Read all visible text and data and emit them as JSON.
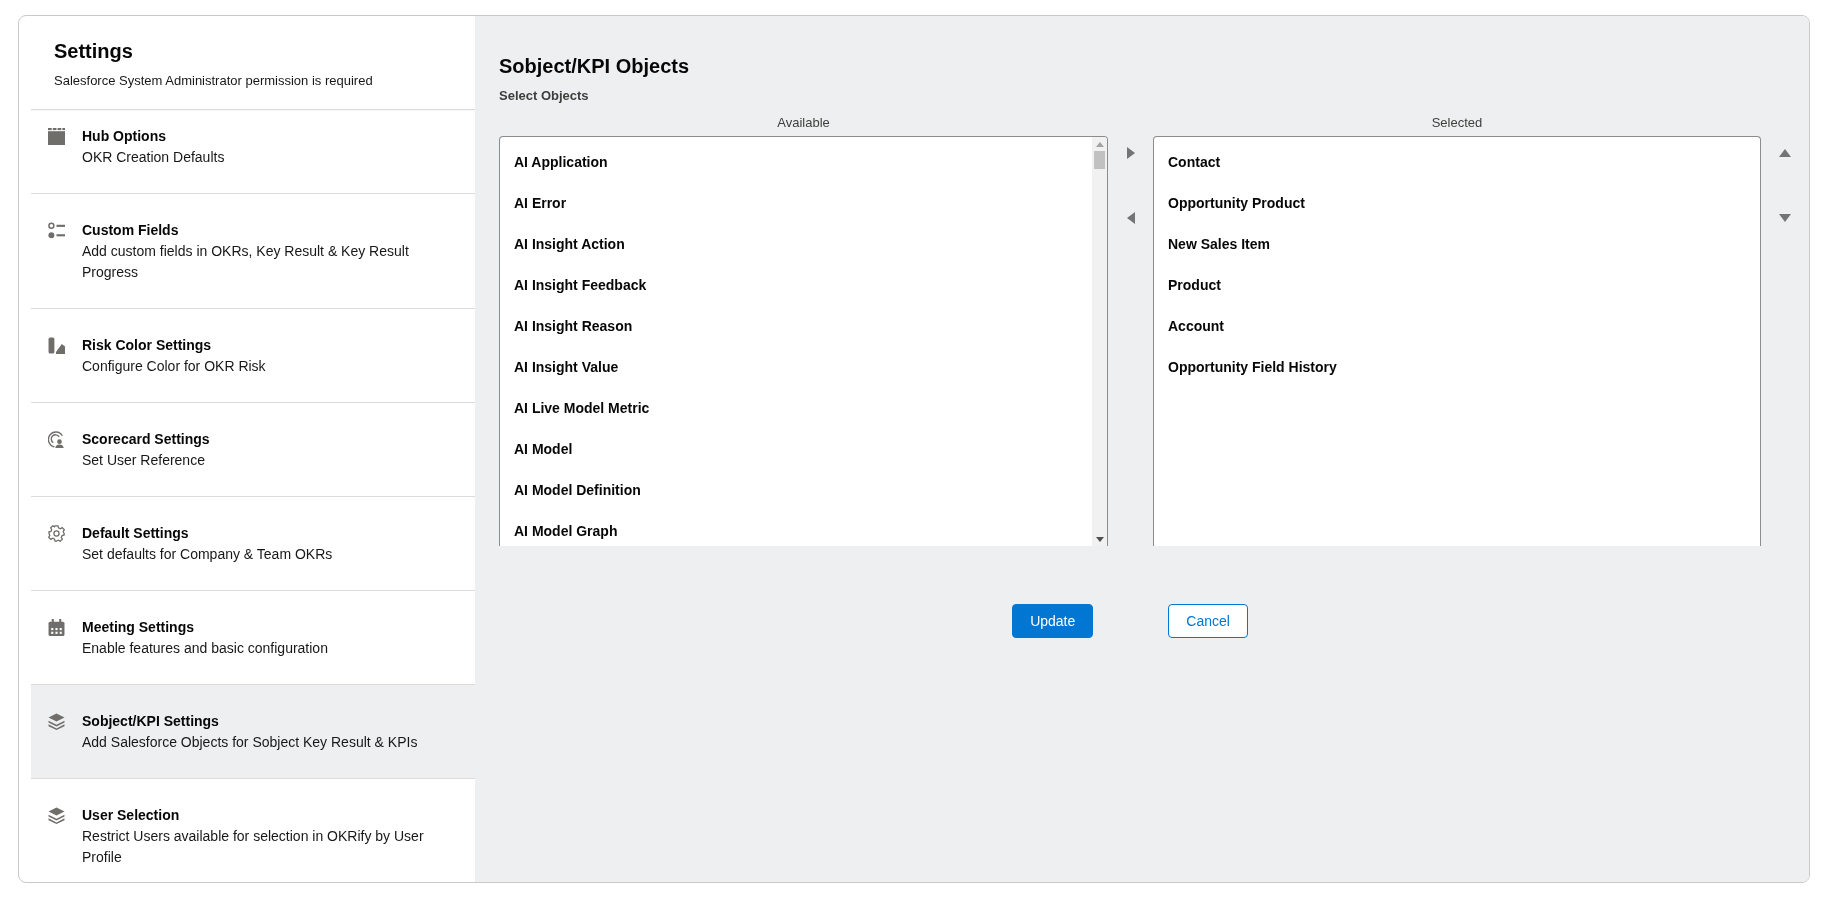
{
  "sidebar": {
    "title": "Settings",
    "subtitle": "Salesforce System Administrator permission is required",
    "items": [
      {
        "title": "Hub Options",
        "description": "OKR Creation Defaults",
        "selected": false
      },
      {
        "title": "Custom Fields",
        "description": "Add custom fields in OKRs, Key Result & Key Result Progress",
        "selected": false
      },
      {
        "title": "Risk Color Settings",
        "description": "Configure Color for OKR Risk",
        "selected": false
      },
      {
        "title": "Scorecard Settings",
        "description": "Set User Reference",
        "selected": false
      },
      {
        "title": "Default Settings",
        "description": "Set defaults for Company & Team OKRs",
        "selected": false
      },
      {
        "title": "Meeting Settings",
        "description": "Enable features and basic configuration",
        "selected": false
      },
      {
        "title": "Sobject/KPI Settings",
        "description": "Add Salesforce Objects for Sobject Key Result & KPIs",
        "selected": true
      },
      {
        "title": "User Selection",
        "description": "Restrict Users available for selection in OKRify by User Profile",
        "selected": false
      }
    ]
  },
  "main": {
    "title": "Sobject/KPI Objects",
    "section_label": "Select Objects",
    "available": {
      "label": "Available",
      "options": [
        {
          "label": "AI Application",
          "selected": false
        },
        {
          "label": "AI Error",
          "selected": false
        },
        {
          "label": "AI Insight Action",
          "selected": false
        },
        {
          "label": "AI Insight Feedback",
          "selected": false
        },
        {
          "label": "AI Insight Reason",
          "selected": false
        },
        {
          "label": "AI Insight Value",
          "selected": false
        },
        {
          "label": "AI Live Model Metric",
          "selected": false
        },
        {
          "label": "AI Model",
          "selected": false
        },
        {
          "label": "AI Model Definition",
          "selected": false
        },
        {
          "label": "AI Model Graph",
          "selected": false
        }
      ]
    },
    "selected": {
      "label": "Selected",
      "options": [
        {
          "label": "Contact",
          "selected": false
        },
        {
          "label": "Opportunity Product",
          "selected": false
        },
        {
          "label": "New Sales Item",
          "selected": false
        },
        {
          "label": "Product",
          "selected": false
        },
        {
          "label": "Account",
          "selected": false
        },
        {
          "label": "Opportunity Field History",
          "selected": false
        }
      ]
    },
    "buttons": [
      {
        "label": "Update",
        "kind": "primary"
      },
      {
        "label": "Cancel",
        "kind": "neutral"
      }
    ]
  }
}
